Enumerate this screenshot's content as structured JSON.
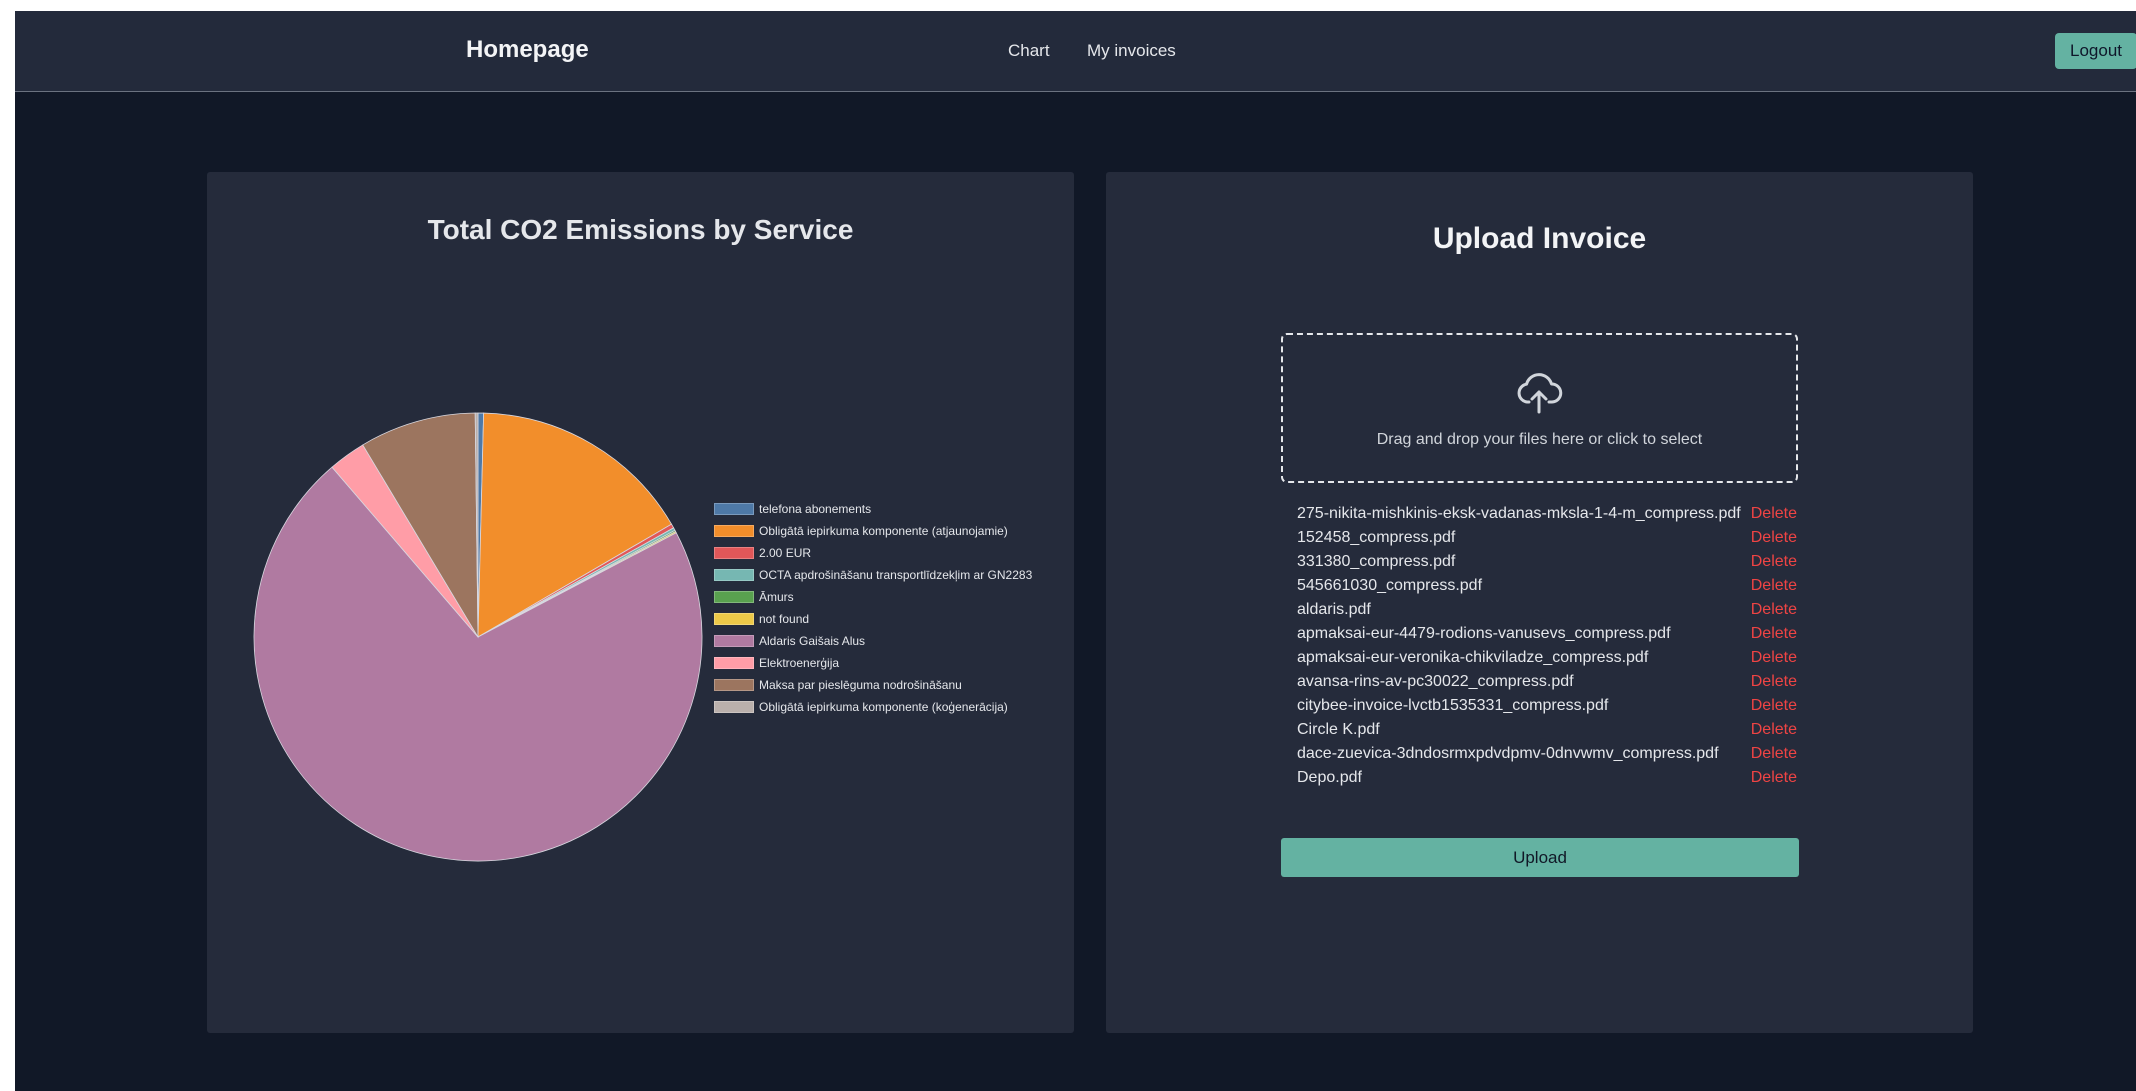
{
  "navbar": {
    "brand": "Homepage",
    "links": [
      "Chart",
      "My invoices"
    ],
    "logout_label": "Logout",
    "accent_color": "#64b2a2"
  },
  "chart_card": {
    "title": "Total CO2 Emissions by Service"
  },
  "chart_data": {
    "type": "pie",
    "title": "Total CO2 Emissions by Service",
    "legend_position": "right",
    "categories": [
      "telefona abonements",
      "Obligātā iepirkuma komponente (atjaunojamie)",
      "2.00 EUR",
      "OCTA apdrošināšanu transportlīdzekļim ar GN2283",
      "Āmurs",
      "not found",
      "Aldaris Gaišais Alus",
      "Elektroenerģija",
      "Maksa par pieslēguma nodrošināšanu",
      "Obligātā iepirkuma komponente (koģenerācija)"
    ],
    "values": [
      0.4,
      16.2,
      0.3,
      0.2,
      0.1,
      0.1,
      71.4,
      2.7,
      8.4,
      0.2
    ],
    "colors": [
      "#4e79a7",
      "#f28e2b",
      "#e15759",
      "#76b7b2",
      "#59a14f",
      "#edc948",
      "#b07aa1",
      "#ff9da7",
      "#9c755f",
      "#bab0ac"
    ]
  },
  "upload": {
    "title": "Upload Invoice",
    "dropzone_text": "Drag and drop your files here or click to select",
    "delete_label": "Delete",
    "upload_label": "Upload",
    "files": [
      "275-nikita-mishkinis-eksk-vadanas-mksla-1-4-m_compress.pdf",
      "152458_compress.pdf",
      "331380_compress.pdf",
      "545661030_compress.pdf",
      "aldaris.pdf",
      "apmaksai-eur-4479-rodions-vanusevs_compress.pdf",
      "apmaksai-eur-veronika-chikviladze_compress.pdf",
      "avansa-rins-av-pc30022_compress.pdf",
      "citybee-invoice-lvctb1535331_compress.pdf",
      "Circle K.pdf",
      "dace-zuevica-3dndosrmxpdvdpmv-0dnvwmv_compress.pdf",
      "Depo.pdf"
    ]
  }
}
